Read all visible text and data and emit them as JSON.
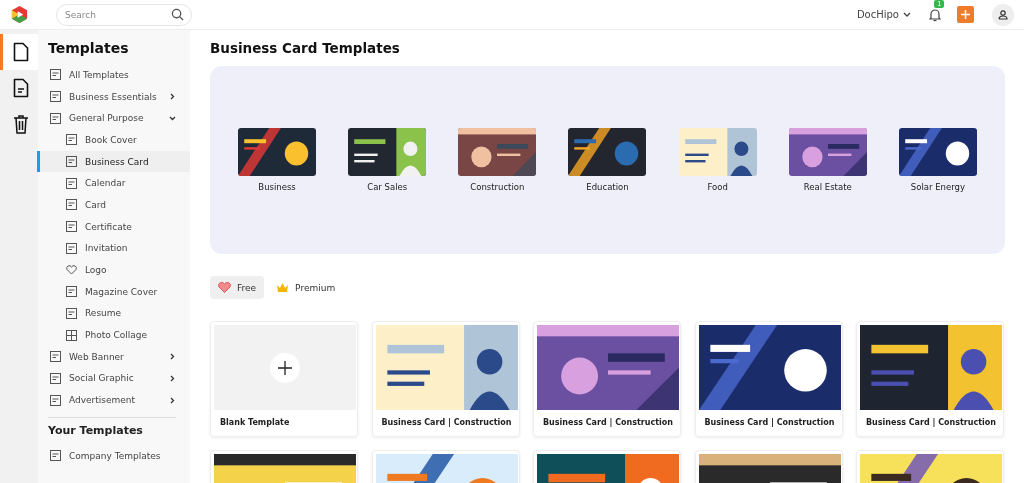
{
  "top_bar": {
    "search": {
      "placeholder": "Search"
    },
    "account": "DocHipo",
    "notification_count": "1"
  },
  "rail": [
    {
      "kind": "file",
      "selected": true
    },
    {
      "kind": "doc",
      "selected": false
    },
    {
      "kind": "trash",
      "selected": false
    }
  ],
  "sidebar": {
    "title": "Templates",
    "items": [
      {
        "label": "All Templates"
      },
      {
        "label": "Business Essentials",
        "expanded": false
      },
      {
        "label": "General Purpose",
        "expanded": true,
        "children": [
          {
            "label": "Book Cover",
            "selected": false
          },
          {
            "label": "Business Card",
            "selected": true
          },
          {
            "label": "Calendar",
            "selected": false
          },
          {
            "label": "Card",
            "selected": false
          },
          {
            "label": "Certificate",
            "selected": false
          },
          {
            "label": "Invitation",
            "selected": false
          },
          {
            "label": "Logo",
            "selected": false
          },
          {
            "label": "Magazine Cover",
            "selected": false
          },
          {
            "label": "Resume",
            "selected": false
          },
          {
            "label": "Photo Collage",
            "selected": false
          }
        ]
      },
      {
        "label": "Web Banner",
        "expanded": false
      },
      {
        "label": "Social Graphic",
        "expanded": false
      },
      {
        "label": "Advertisement",
        "expanded": false
      }
    ],
    "section_title": "Your Templates",
    "section_items": [
      {
        "label": "Company Templates"
      }
    ]
  },
  "main": {
    "title": "Business Card Templates",
    "categories": [
      {
        "label": "Business"
      },
      {
        "label": "Car Sales"
      },
      {
        "label": "Construction"
      },
      {
        "label": "Education"
      },
      {
        "label": "Food"
      },
      {
        "label": "Real Estate"
      },
      {
        "label": "Solar Energy"
      }
    ],
    "filters": [
      {
        "label": "Free",
        "kind": "heart",
        "selected": true
      },
      {
        "label": "Premium",
        "kind": "crown",
        "selected": false
      }
    ],
    "templates": [
      {
        "kind": "blank",
        "label": "Blank Template"
      },
      {
        "kind": "design",
        "label": "Business Card | Construction"
      },
      {
        "kind": "design",
        "label": "Business Card | Construction"
      },
      {
        "kind": "design",
        "label": "Business Card | Construction"
      },
      {
        "kind": "design",
        "label": "Business Card | Construction"
      },
      {
        "kind": "design"
      },
      {
        "kind": "design"
      },
      {
        "kind": "design"
      },
      {
        "kind": "design"
      },
      {
        "kind": "design"
      }
    ]
  }
}
